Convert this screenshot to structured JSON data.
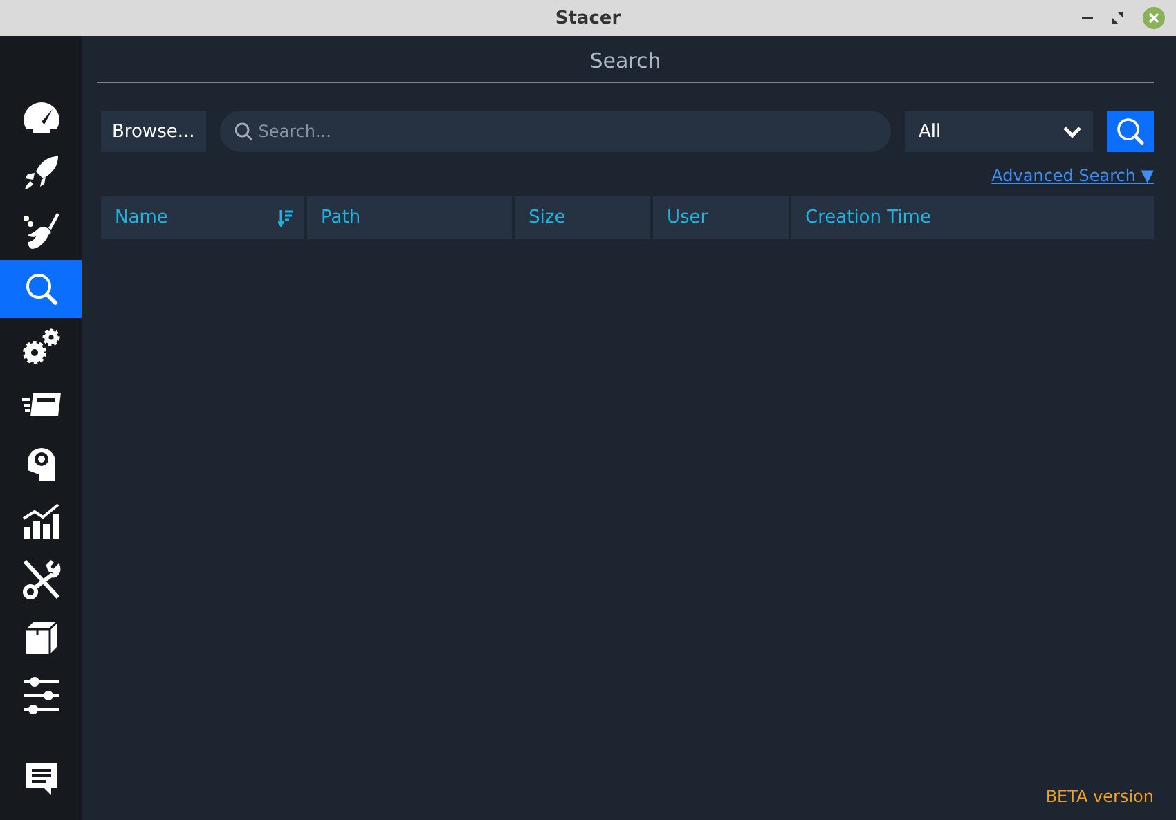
{
  "window": {
    "title": "Stacer"
  },
  "sidebar": {
    "items": [
      {
        "selected": false
      },
      {
        "selected": false
      },
      {
        "selected": false
      },
      {
        "selected": true
      },
      {
        "selected": false
      },
      {
        "selected": false
      },
      {
        "selected": false
      },
      {
        "selected": false
      },
      {
        "selected": false
      },
      {
        "selected": false
      },
      {
        "selected": false
      }
    ]
  },
  "page_title": "Search",
  "browse_button": "Browse...",
  "search": {
    "placeholder": "Search..."
  },
  "filter": {
    "value": "All"
  },
  "advanced_link": "Advanced Search ▼",
  "table": {
    "columns": [
      {
        "label": "Name",
        "sorted": true
      },
      {
        "label": "Path",
        "sorted": false
      },
      {
        "label": "Size",
        "sorted": false
      },
      {
        "label": "User",
        "sorted": false
      },
      {
        "label": "Creation Time",
        "sorted": false
      }
    ]
  },
  "footer": "BETA version"
}
